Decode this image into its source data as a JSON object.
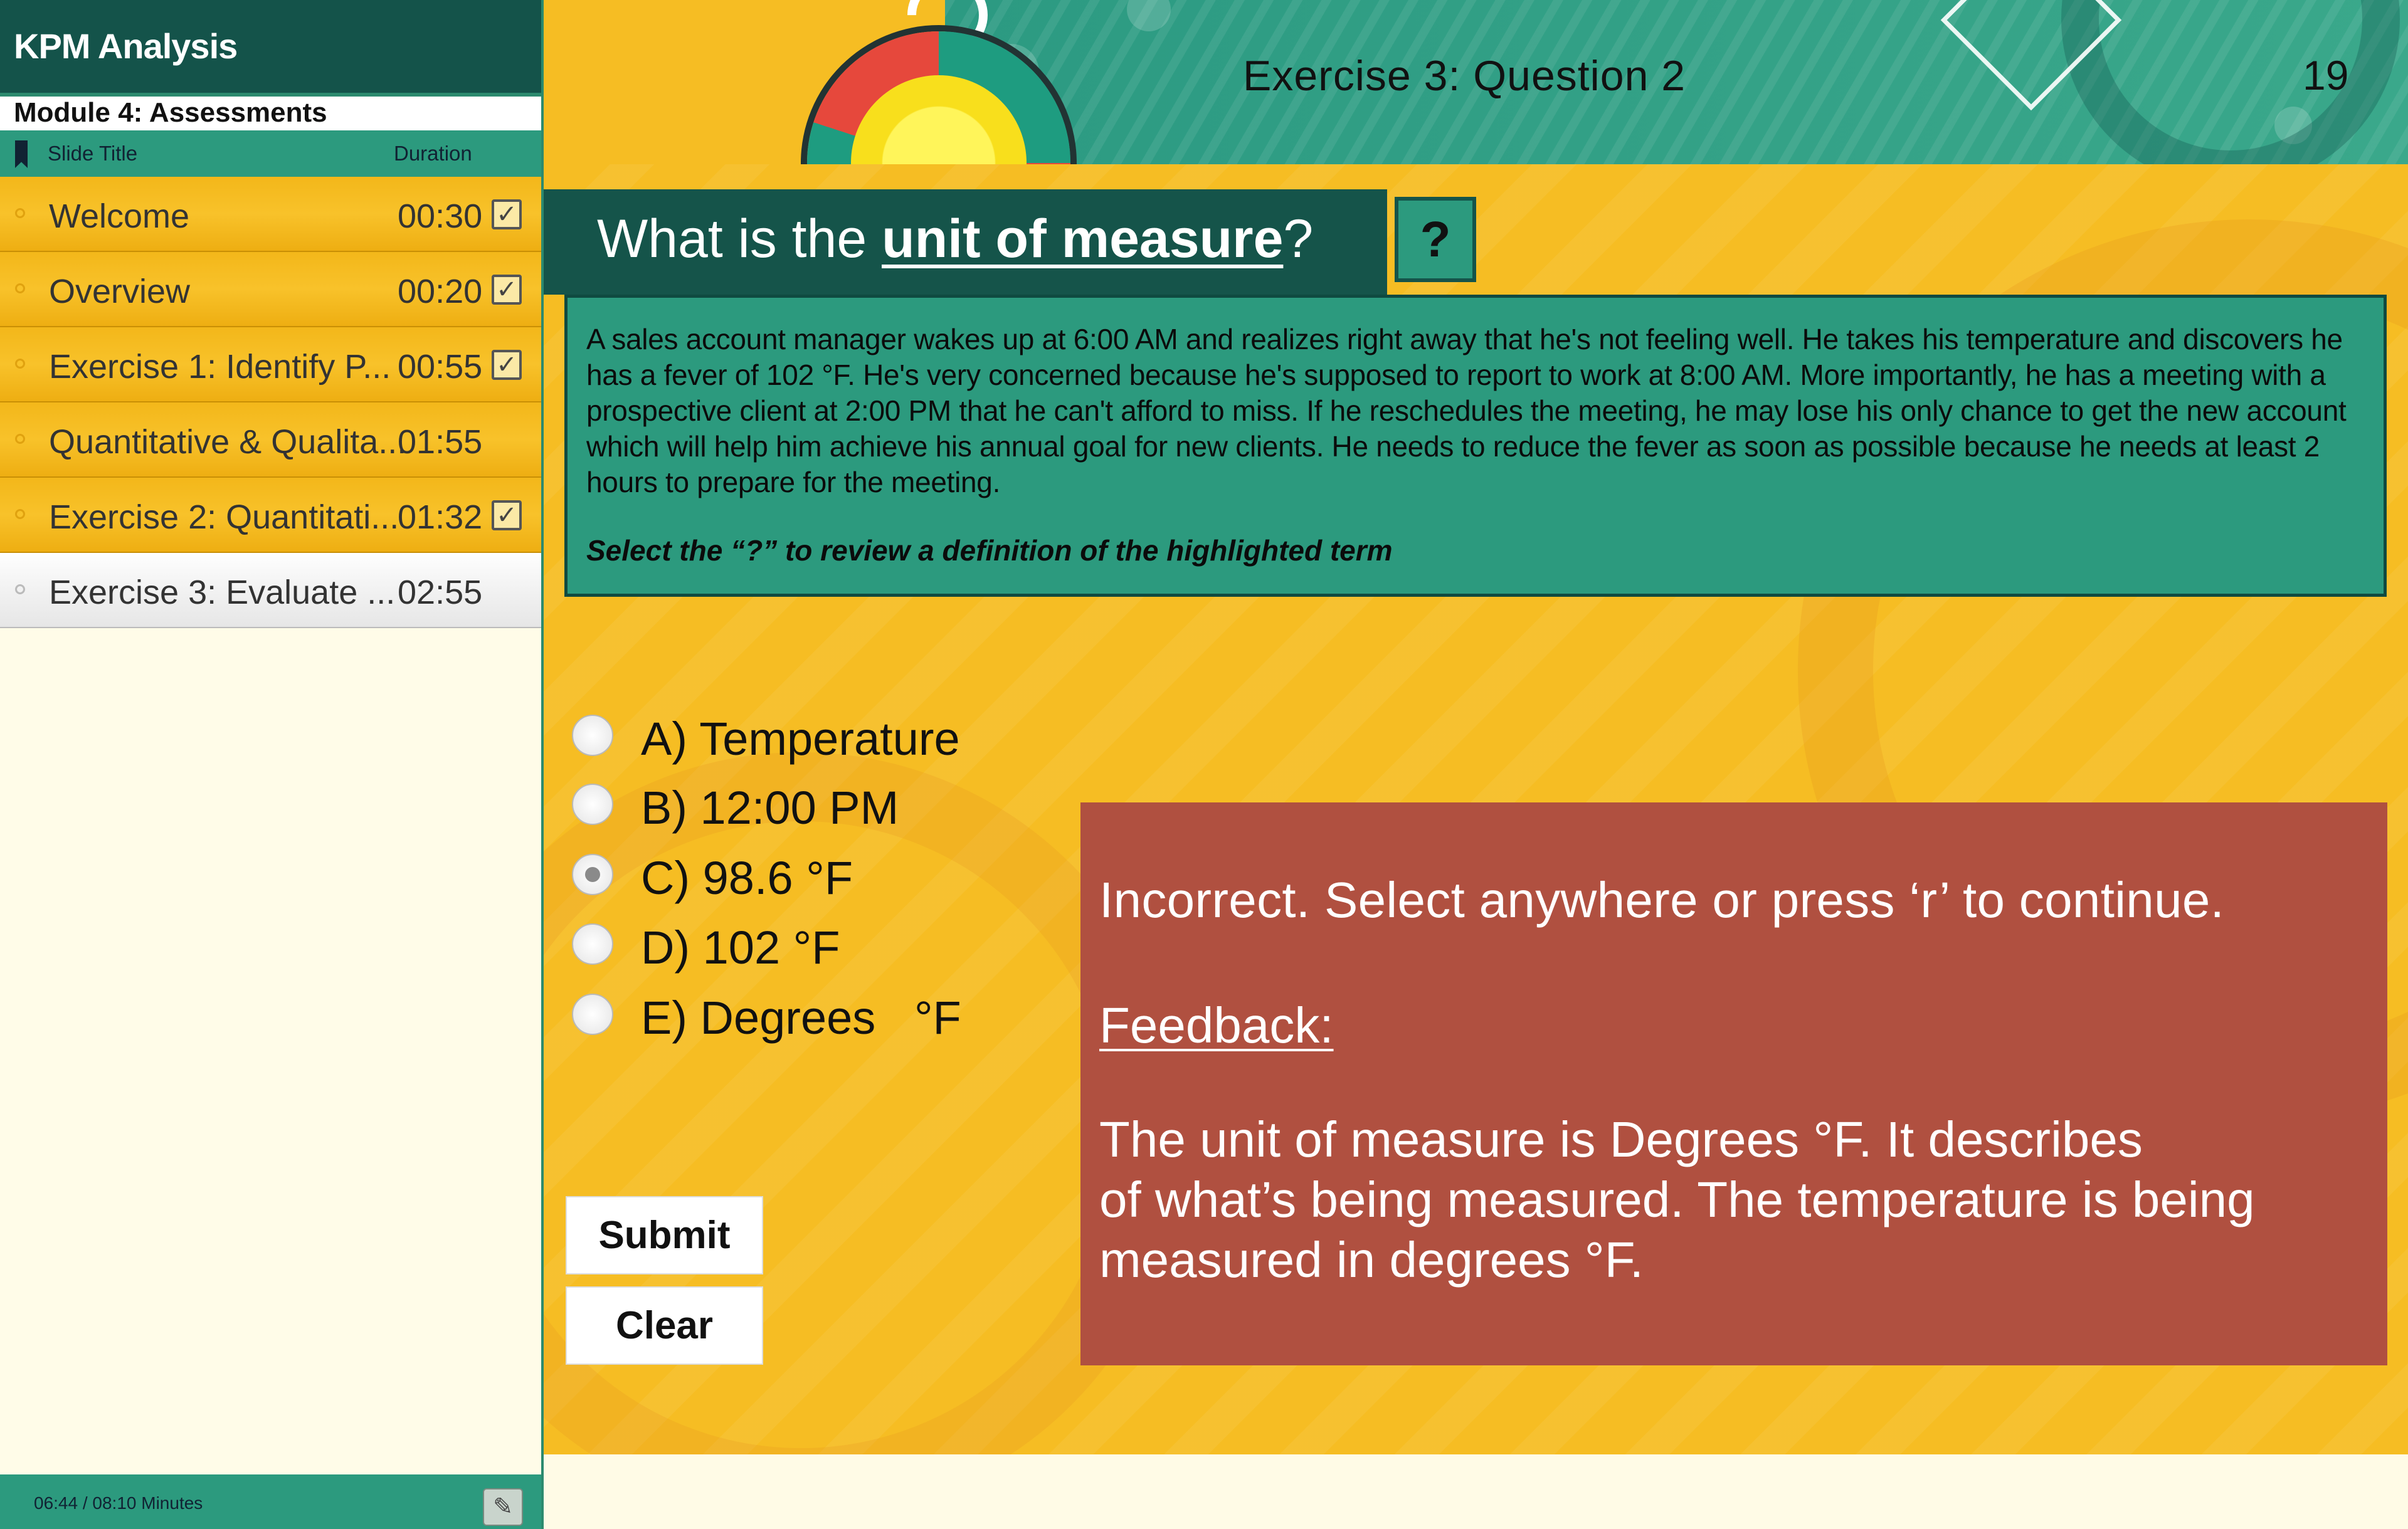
{
  "sidebar": {
    "course_title": "KPM Analysis",
    "module_title": "Module 4: Assessments",
    "columns": {
      "title": "Slide Title",
      "duration": "Duration"
    },
    "items": [
      {
        "label": "Welcome",
        "duration": "00:30",
        "checked": true,
        "active": false
      },
      {
        "label": "Overview",
        "duration": "00:20",
        "checked": true,
        "active": false
      },
      {
        "label": "Exercise 1: Identify P...",
        "duration": "00:55",
        "checked": true,
        "active": false
      },
      {
        "label": "Quantitative & Qualita...",
        "duration": "01:55",
        "checked": false,
        "active": false
      },
      {
        "label": "Exercise 2: Quantitati...",
        "duration": "01:32",
        "checked": true,
        "active": false
      },
      {
        "label": "Exercise 3: Evaluate ...",
        "duration": "02:55",
        "checked": false,
        "active": true
      }
    ],
    "footer": {
      "elapsed": "06:44 / 08:10 Minutes",
      "icon": "pencil-icon"
    },
    "colors": {
      "header": "#14534a",
      "accent": "#2c9a7e",
      "row": "#f8c22a"
    }
  },
  "slide": {
    "exercise_title": "Exercise 3: Question 2",
    "slide_number": "19",
    "question": {
      "prefix": "What is the ",
      "highlight": "unit of measure",
      "suffix": "?"
    },
    "help_button": "?",
    "scenario": "A sales account manager wakes up at 6:00 AM and realizes right away that he's not feeling well. He takes his temperature and discovers he has a fever of 102 °F. He's very concerned because he's supposed to report to work at 8:00 AM. More importantly, he has a meeting with a prospective client at 2:00 PM that he can't afford to miss. If he reschedules the meeting, he may lose his only chance to get the new account which will help him achieve his annual goal for new clients. He needs to reduce the fever as soon as possible because he needs at least 2 hours to prepare for the meeting.",
    "instruction": "Select the “?” to review a definition of the highlighted term",
    "choices": [
      {
        "label": "A) Temperature",
        "selected": false
      },
      {
        "label": "B) 12:00 PM",
        "selected": false
      },
      {
        "label": "C) 98.6 °F",
        "selected": true
      },
      {
        "label": "D) 102 °F",
        "selected": false
      },
      {
        "label": "E) Degrees   °F",
        "selected": false
      }
    ],
    "buttons": {
      "submit": "Submit",
      "clear": "Clear"
    },
    "feedback": {
      "incorrect": "Incorrect. Select anywhere or press ‘r’ to continue.",
      "heading": "Feedback:",
      "body_line1": "The unit of measure is Degrees °F. It describes",
      "body_line2": "of what’s being measured. The temperature is being",
      "body_line3": "measured in degrees °F."
    },
    "colors": {
      "background": "#f6bd23",
      "dark_green": "#15544a",
      "teal": "#2c9a7e",
      "feedback": "#b05040"
    }
  }
}
